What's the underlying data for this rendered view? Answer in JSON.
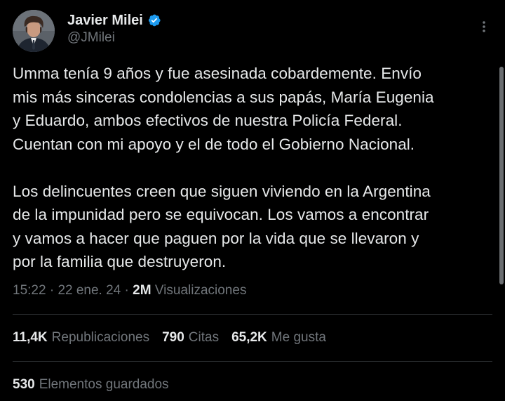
{
  "author": {
    "display_name": "Javier Milei",
    "handle": "@JMilei",
    "verified": true,
    "verified_color": "#1d9bf0",
    "avatar_icon": "profile-photo"
  },
  "tweet": {
    "text": "Umma tenía 9 años y fue asesinada cobardemente. Envío\nmis más sinceras condolencias a sus papás, María Eugenia\ny Eduardo, ambos efectivos de nuestra Policía Federal.\nCuentan con mi apoyo y el de todo el Gobierno Nacional.\n\nLos delincuentes creen que siguen viviendo en la Argentina\nde la impunidad pero se equivocan. Los vamos a encontrar\ny vamos a hacer que paguen por la vida que se llevaron y\npor la familia que destruyeron."
  },
  "meta": {
    "time": "15:22",
    "separator": " · ",
    "date": "22 ene. 24",
    "views_count": "2M",
    "views_label": "Visualizaciones"
  },
  "stats": {
    "reposts_count": "11,4K",
    "reposts_label": "Republicaciones",
    "quotes_count": "790",
    "quotes_label": "Citas",
    "likes_count": "65,2K",
    "likes_label": "Me gusta",
    "bookmarks_count": "530",
    "bookmarks_label": "Elementos guardados"
  },
  "colors": {
    "background": "#000000",
    "primary_text": "#e7e9ea",
    "secondary_text": "#71767b",
    "divider": "#2f3336"
  }
}
